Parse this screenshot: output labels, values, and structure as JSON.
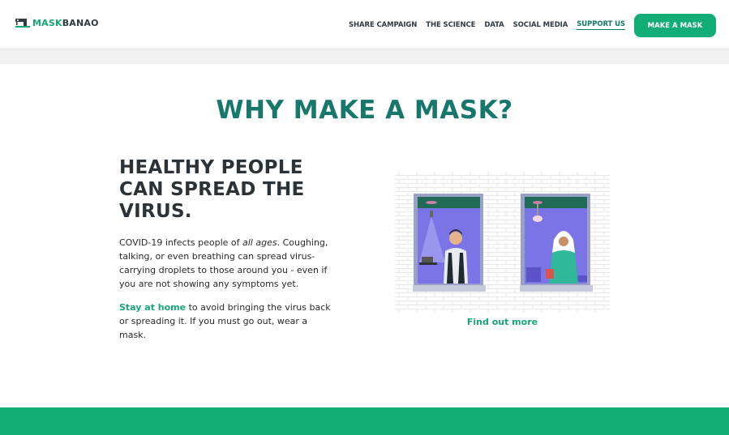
{
  "header": {
    "logo": {
      "mask": "MASK",
      "banao": "BANAO"
    },
    "nav": [
      {
        "label": "SHARE CAMPAIGN",
        "active": false
      },
      {
        "label": "THE SCIENCE",
        "active": false
      },
      {
        "label": "DATA",
        "active": false
      },
      {
        "label": "SOCIAL MEDIA",
        "active": false
      },
      {
        "label": "SUPPORT US",
        "active": true
      }
    ],
    "cta_label": "MAKE A MASK"
  },
  "section": {
    "title": "WHY MAKE A MASK?",
    "heading": "HEALTHY PEOPLE CAN SPREAD THE VIRUS.",
    "para1": {
      "before": "COVID-19 infects people of ",
      "emphasis": "all ages",
      "after": ". Coughing, talking, or even breathing can spread virus-carrying droplets to those around you - even if you are not showing any symptoms yet."
    },
    "para2": {
      "link": "Stay at home",
      "after": " to avoid bringing the virus back or spreading it. If you must go out, wear a mask."
    },
    "find_more": "Find out more"
  },
  "colors": {
    "brand_green": "#12ad74",
    "title_teal": "#17776a",
    "heading_dark": "#2b3338"
  }
}
